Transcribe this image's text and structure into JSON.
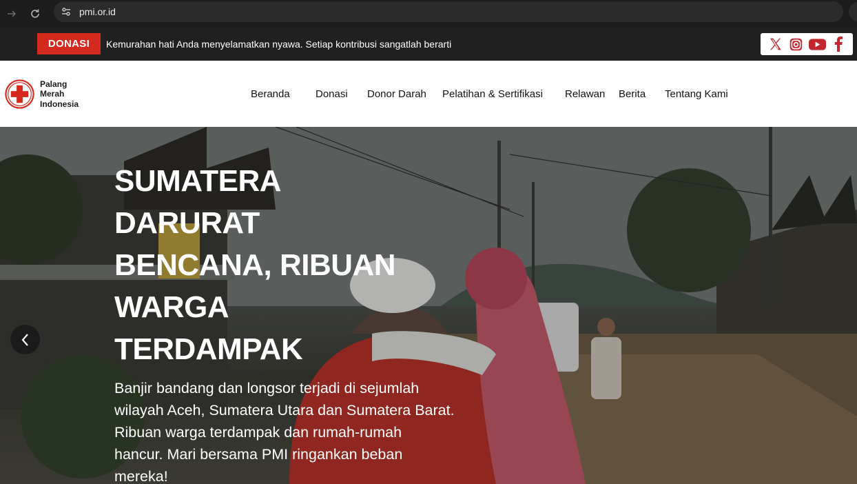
{
  "browser": {
    "url": "pmi.or.id",
    "icons": [
      "arrow-forward-icon",
      "reload-icon",
      "site-settings-icon"
    ]
  },
  "topbar": {
    "donate_label": "DONASI",
    "tagline": "Kemurahan hati Anda menyelamatkan nyawa. Setiap kontribusi sangatlah berarti",
    "social": [
      "x-icon",
      "instagram-icon",
      "youtube-icon",
      "facebook-icon"
    ]
  },
  "header": {
    "logo": {
      "line1": "Palang",
      "line2": "Merah",
      "line3": "Indonesia"
    },
    "nav": [
      {
        "label": "Beranda"
      },
      {
        "label": "Donasi"
      },
      {
        "label": "Donor Darah"
      },
      {
        "label": "Pelatihan & Sertifikasi"
      },
      {
        "label": "Relawan"
      },
      {
        "label": "Berita"
      },
      {
        "label": "Tentang Kami"
      }
    ]
  },
  "hero": {
    "title_lines": [
      "SUMATERA",
      "DARURAT",
      "BENCANA, RIBUAN",
      "WARGA",
      "TERDAMPAK"
    ],
    "description_lines": [
      "Banjir bandang dan longsor terjadi di sejumlah",
      "wilayah Aceh, Sumatera Utara dan Sumatera Barat.",
      "Ribuan warga terdampak dan rumah-rumah",
      "hancur. Mari bersama PMI ringankan beban",
      "mereka!"
    ]
  },
  "colors": {
    "brand_red": "#d42a1e",
    "topbar_bg": "#202020",
    "header_bg": "#ffffff"
  }
}
